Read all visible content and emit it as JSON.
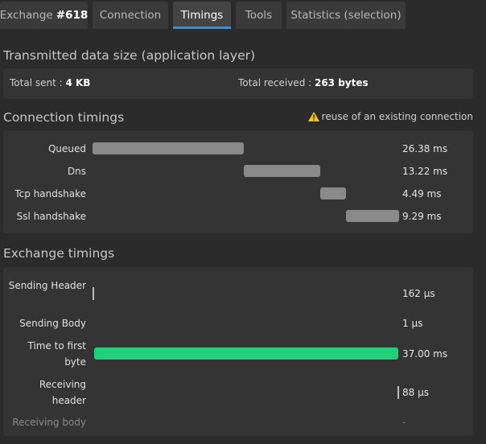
{
  "tabs": [
    {
      "label": "Exchange",
      "id_text": "#618"
    },
    {
      "label": "Connection"
    },
    {
      "label": "Timings",
      "active": true
    },
    {
      "label": "Tools"
    },
    {
      "label": "Statistics (selection)"
    }
  ],
  "transmitted": {
    "title": "Transmitted data size (application layer)",
    "sent_label": "Total sent : ",
    "sent_value": "4 KB",
    "received_label": "Total received : ",
    "received_value": "263 bytes"
  },
  "connection": {
    "title": "Connection timings",
    "warning": "reuse of an existing connection",
    "rows": [
      {
        "label": "Queued",
        "value": "26.38 ms",
        "ms": 26.38
      },
      {
        "label": "Dns",
        "value": "13.22 ms",
        "ms": 13.22
      },
      {
        "label": "Tcp handshake",
        "value": "4.49 ms",
        "ms": 4.49
      },
      {
        "label": "Ssl handshake",
        "value": "9.29 ms",
        "ms": 9.29
      }
    ]
  },
  "exchange": {
    "title": "Exchange timings",
    "rows": [
      {
        "label": "Sending Header",
        "value": "162 μs"
      },
      {
        "label": "Sending Body",
        "value": "1 μs"
      },
      {
        "label": "Time to first byte",
        "value": "37.00 ms"
      },
      {
        "label": "Receiving header",
        "value": "88 μs"
      },
      {
        "label": "Receiving body",
        "value": "-"
      }
    ]
  },
  "colors": {
    "accent": "#3c8fd6",
    "bar_gray": "#8a8a8a",
    "bar_green": "#1ed07a",
    "warning": "#f5c518"
  }
}
